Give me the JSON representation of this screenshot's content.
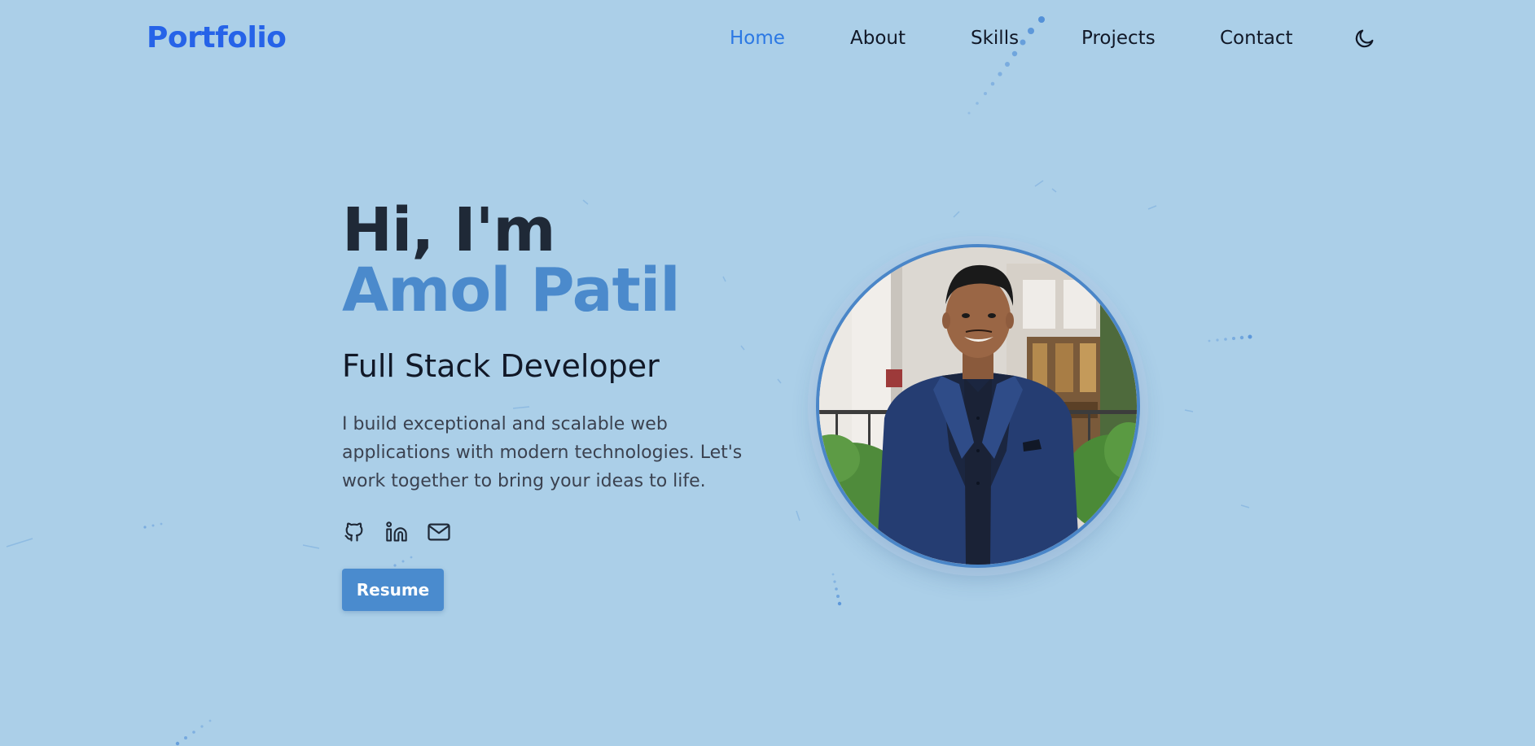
{
  "nav": {
    "logo": "Portfolio",
    "links": [
      {
        "label": "Home",
        "active": true
      },
      {
        "label": "About",
        "active": false
      },
      {
        "label": "Skills",
        "active": false
      },
      {
        "label": "Projects",
        "active": false
      },
      {
        "label": "Contact",
        "active": false
      }
    ],
    "theme_toggle_icon": "moon-icon"
  },
  "hero": {
    "greeting": "Hi, I'm",
    "name": "Amol Patil",
    "role": "Full Stack Developer",
    "description": "I build exceptional and scalable web applications with modern technologies. Let's work together to bring your ideas to life.",
    "socials": [
      {
        "icon": "github-icon"
      },
      {
        "icon": "linkedin-icon"
      },
      {
        "icon": "mail-icon"
      }
    ],
    "resume_label": "Resume"
  },
  "colors": {
    "background": "#abcfe8",
    "logo": "#2663e8",
    "nav_active": "#2b78e4",
    "name_accent": "#4b8acc",
    "button": "#4a8bce",
    "avatar_border": "#4a86c8"
  }
}
